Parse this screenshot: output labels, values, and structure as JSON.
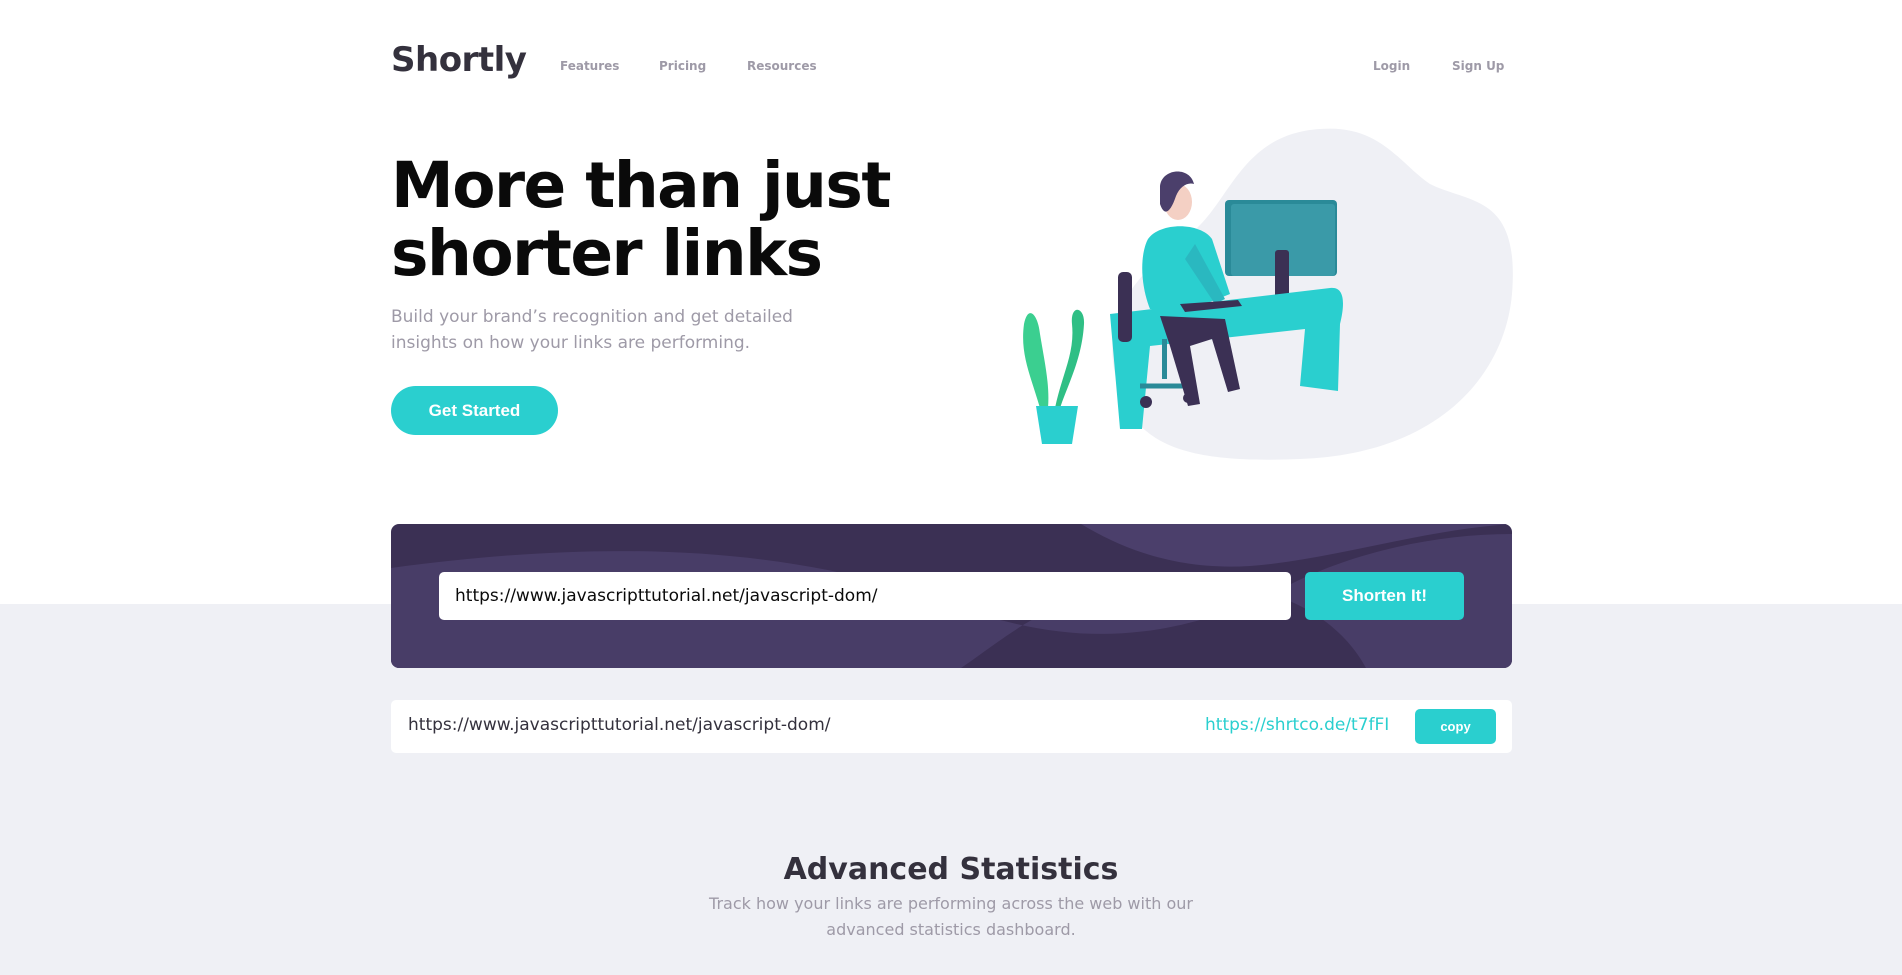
{
  "header": {
    "logo": "Shortly",
    "nav": [
      "Features",
      "Pricing",
      "Resources"
    ],
    "login": "Login",
    "signup": "Sign Up"
  },
  "hero": {
    "title": "More than just shorter links",
    "subtitle": "Build your brand’s recognition and get detailed insights on how your links are performing.",
    "cta": "Get Started"
  },
  "shorten": {
    "input_value": "https://www.javascripttutorial.net/javascript-dom/",
    "button": "Shorten It!"
  },
  "result": {
    "original": "https://www.javascripttutorial.net/javascript-dom/",
    "short": "https://shrtco.de/t7fFI",
    "copy": "copy"
  },
  "stats": {
    "title": "Advanced Statistics",
    "subtitle": "Track how your links are performing across the web with our advanced statistics dashboard."
  },
  "colors": {
    "accent": "#2acfcf",
    "dark_violet": "#3b3054",
    "gray_bg": "#eff0f5",
    "text_gray": "#9e9aa7",
    "dark_text": "#34313d"
  }
}
